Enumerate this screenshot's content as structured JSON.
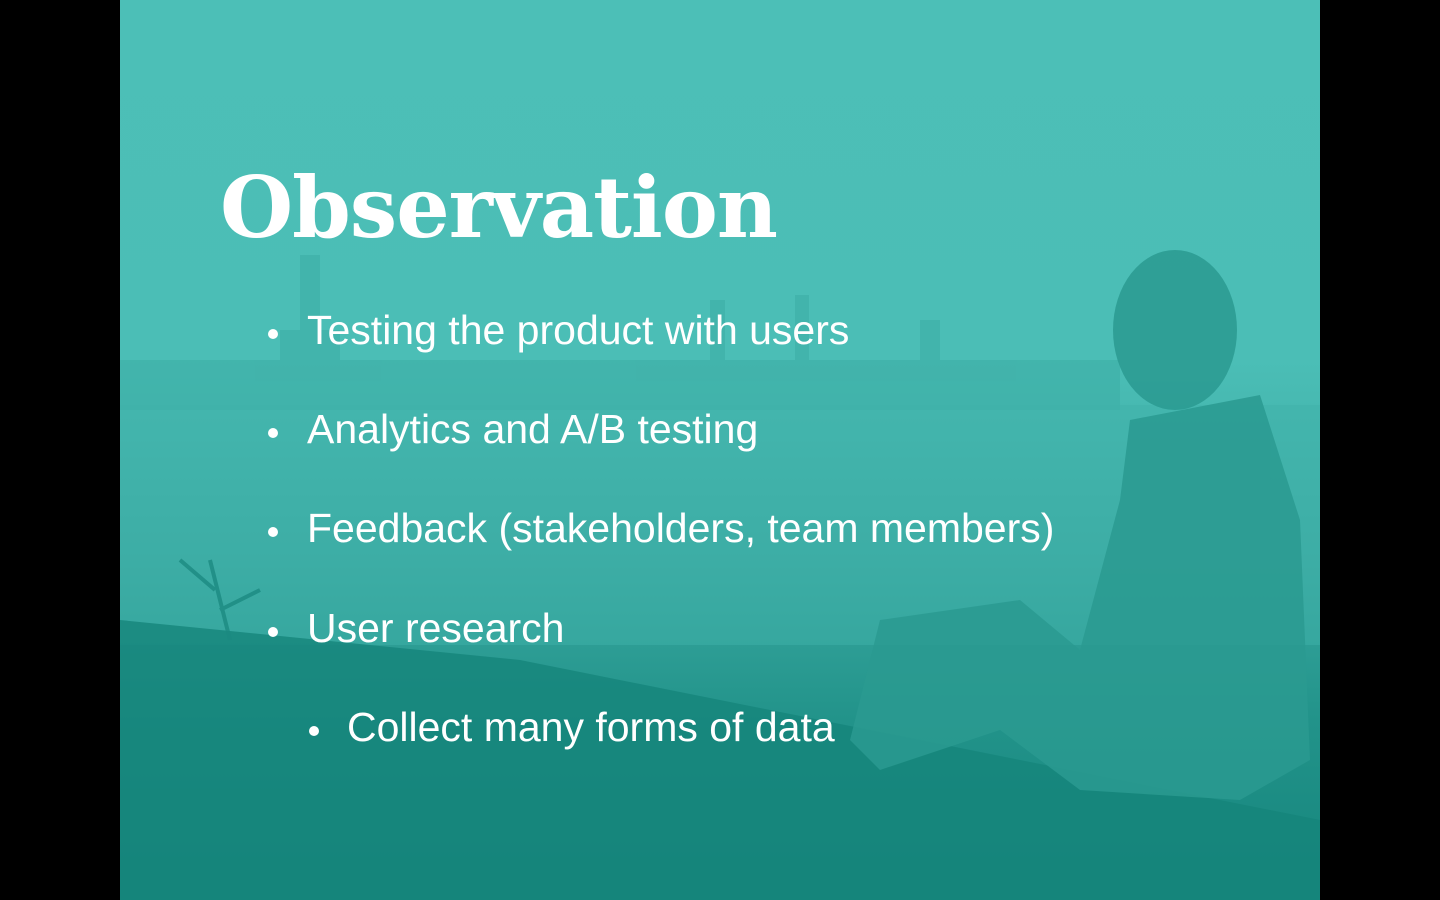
{
  "slide": {
    "title": "Observation",
    "bullets": [
      {
        "text": "Testing the product with users",
        "level": 1
      },
      {
        "text": "Analytics and A/B testing",
        "level": 1
      },
      {
        "text": "Feedback (stakeholders, team members)",
        "level": 1
      },
      {
        "text": "User research",
        "level": 1
      },
      {
        "text": "Collect many forms of data",
        "level": 2
      }
    ],
    "colors": {
      "background_top": "#4cbfb7",
      "background_bottom": "#15857c",
      "text": "#ffffff"
    }
  }
}
